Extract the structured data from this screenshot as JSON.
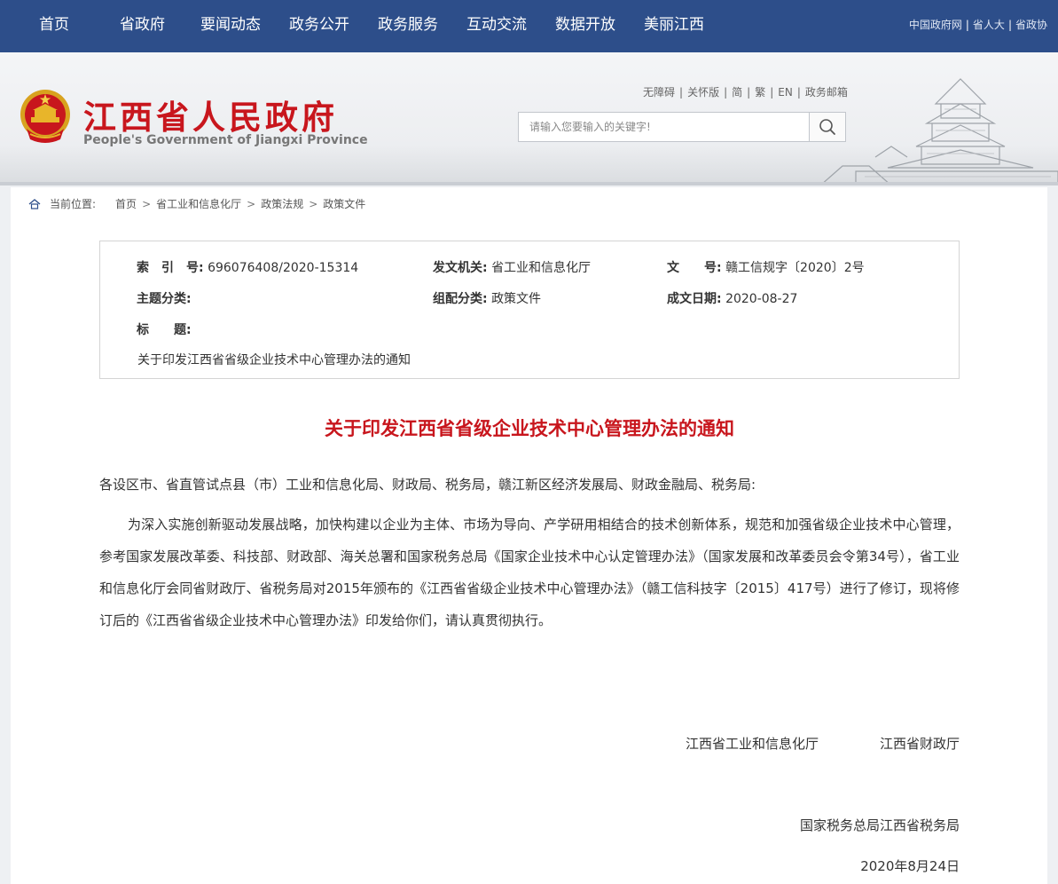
{
  "nav": {
    "items": [
      "首页",
      "省政府",
      "要闻动态",
      "政务公开",
      "政务服务",
      "互动交流",
      "数据开放",
      "美丽江西"
    ],
    "top_links": [
      "中国政府网",
      "省人大",
      "省政协"
    ]
  },
  "header": {
    "title": "江西省人民政府",
    "subtitle": "People's Government of Jiangxi Province",
    "util_links": [
      "无障碍",
      "关怀版",
      "简",
      "繁",
      "EN",
      "政务邮箱"
    ],
    "search_placeholder": "请输入您要输入的关键字!"
  },
  "breadcrumb": {
    "label": "当前位置:",
    "items": [
      "首页",
      "省工业和信息化厅",
      "政策法规",
      "政策文件"
    ]
  },
  "info": {
    "index_label": "索　引　号:",
    "index_value": "696076408/2020-15314",
    "issuer_label": "发文机关:",
    "issuer_value": "省工业和信息化厅",
    "docno_label": "文　　号:",
    "docno_value": "赣工信规字〔2020〕2号",
    "topic_label": "主题分类:",
    "topic_value": "",
    "category_label": "组配分类:",
    "category_value": "政策文件",
    "date_label": "成文日期:",
    "date_value": "2020-08-27",
    "title_label": "标　　题:",
    "title_value": "关于印发江西省省级企业技术中心管理办法的通知"
  },
  "document": {
    "title": "关于印发江西省省级企业技术中心管理办法的通知",
    "salutation": "各设区市、省直管试点县（市）工业和信息化局、财政局、税务局，赣江新区经济发展局、财政金融局、税务局:",
    "body": "为深入实施创新驱动发展战略，加快构建以企业为主体、市场为导向、产学研用相结合的技术创新体系，规范和加强省级企业技术中心管理，参考国家发展改革委、科技部、财政部、海关总署和国家税务总局《国家企业技术中心认定管理办法》（国家发展和改革委员会令第34号），省工业和信息化厅会同省财政厅、省税务局对2015年颁布的《江西省省级企业技术中心管理办法》（赣工信科技字〔2015〕417号）进行了修订，现将修订后的《江西省省级企业技术中心管理办法》印发给你们，请认真贯彻执行。",
    "signer1": "江西省工业和信息化厅",
    "signer2": "江西省财政厅",
    "signer3": "国家税务总局江西省税务局",
    "date": "2020年8月24日"
  }
}
